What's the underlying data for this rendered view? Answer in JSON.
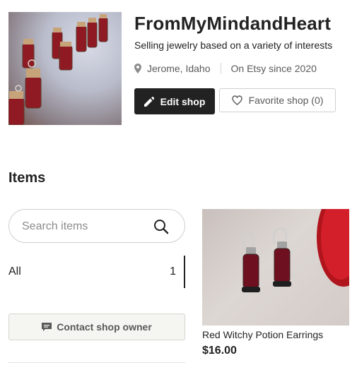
{
  "shop": {
    "name": "FromMyMindandHeart",
    "tagline": "Selling jewelry based on a variety of interests",
    "location": "Jerome, Idaho",
    "since": "On Etsy since 2020",
    "edit_label": "Edit shop",
    "favorite_label": "Favorite shop (0)"
  },
  "items": {
    "heading": "Items",
    "search_placeholder": "Search items",
    "sections": [
      {
        "label": "All",
        "count": "1"
      }
    ],
    "contact_label": "Contact shop owner"
  },
  "listings": [
    {
      "title": "Red Witchy Potion Earrings",
      "price": "$16.00"
    }
  ],
  "icons": {
    "location": "location-pin-icon",
    "edit": "pencil-icon",
    "favorite": "heart-icon",
    "search": "search-icon",
    "contact": "message-icon"
  },
  "colors": {
    "primary_button": "#222222",
    "text": "#222222",
    "muted_text": "#595959",
    "border": "#cfcfcf"
  }
}
